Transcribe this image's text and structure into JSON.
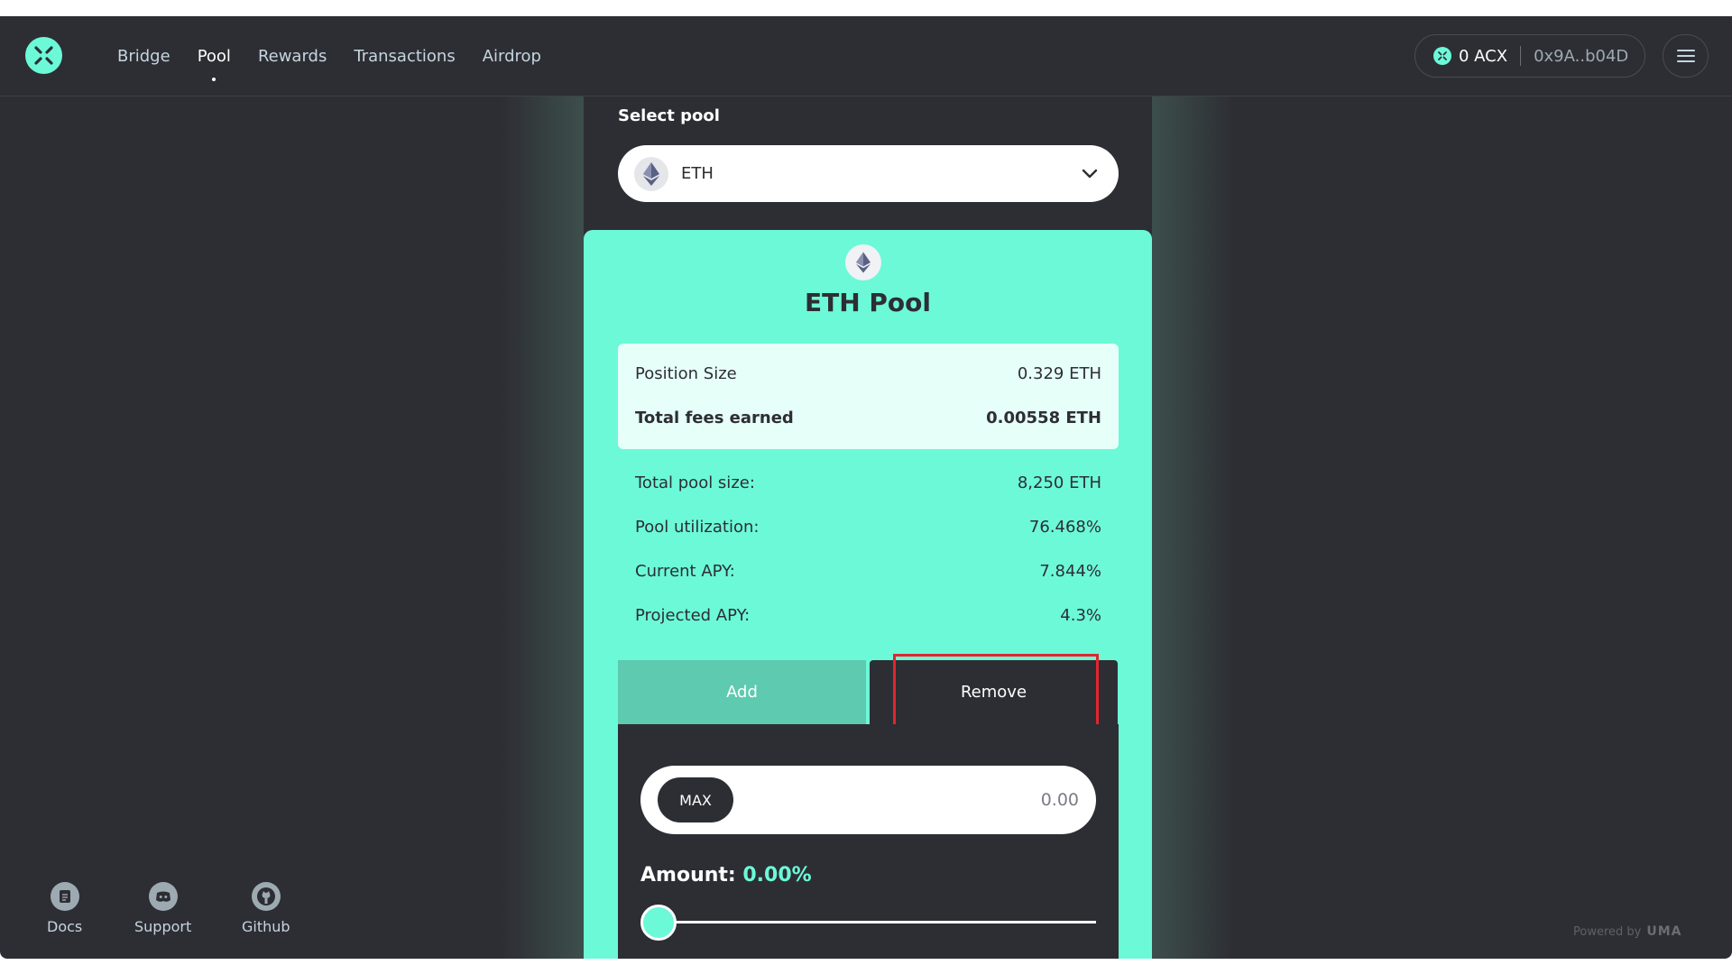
{
  "header": {
    "nav": [
      {
        "label": "Bridge"
      },
      {
        "label": "Pool"
      },
      {
        "label": "Rewards"
      },
      {
        "label": "Transactions"
      },
      {
        "label": "Airdrop"
      }
    ],
    "active_nav": "Pool",
    "acx_balance": "0 ACX",
    "wallet_address": "0x9A..b04D"
  },
  "pool_select": {
    "label": "Select pool",
    "selected": "ETH"
  },
  "pool_card": {
    "title": "ETH Pool",
    "position": {
      "size_label": "Position Size",
      "size_value": "0.329 ETH",
      "fees_label": "Total fees earned",
      "fees_value": "0.00558 ETH"
    },
    "stats": [
      {
        "label": "Total pool size:",
        "value": "8,250 ETH"
      },
      {
        "label": "Pool utilization:",
        "value": "76.468%"
      },
      {
        "label": "Current APY:",
        "value": "7.844%"
      },
      {
        "label": "Projected APY:",
        "value": "4.3%"
      }
    ],
    "tabs": {
      "add": "Add",
      "remove": "Remove",
      "active": "Remove"
    },
    "max_label": "MAX",
    "amount_value": "0.00",
    "amount_label": "Amount:",
    "amount_percent": "0.00%",
    "slider_fraction": 0
  },
  "footer": {
    "links": [
      {
        "label": "Docs"
      },
      {
        "label": "Support"
      },
      {
        "label": "Github"
      }
    ],
    "powered_by": "Powered by",
    "powered_brand": "UMA"
  },
  "colors": {
    "accent": "#6cf9d8",
    "background": "#2d2e33",
    "highlight": "#e0262f"
  }
}
